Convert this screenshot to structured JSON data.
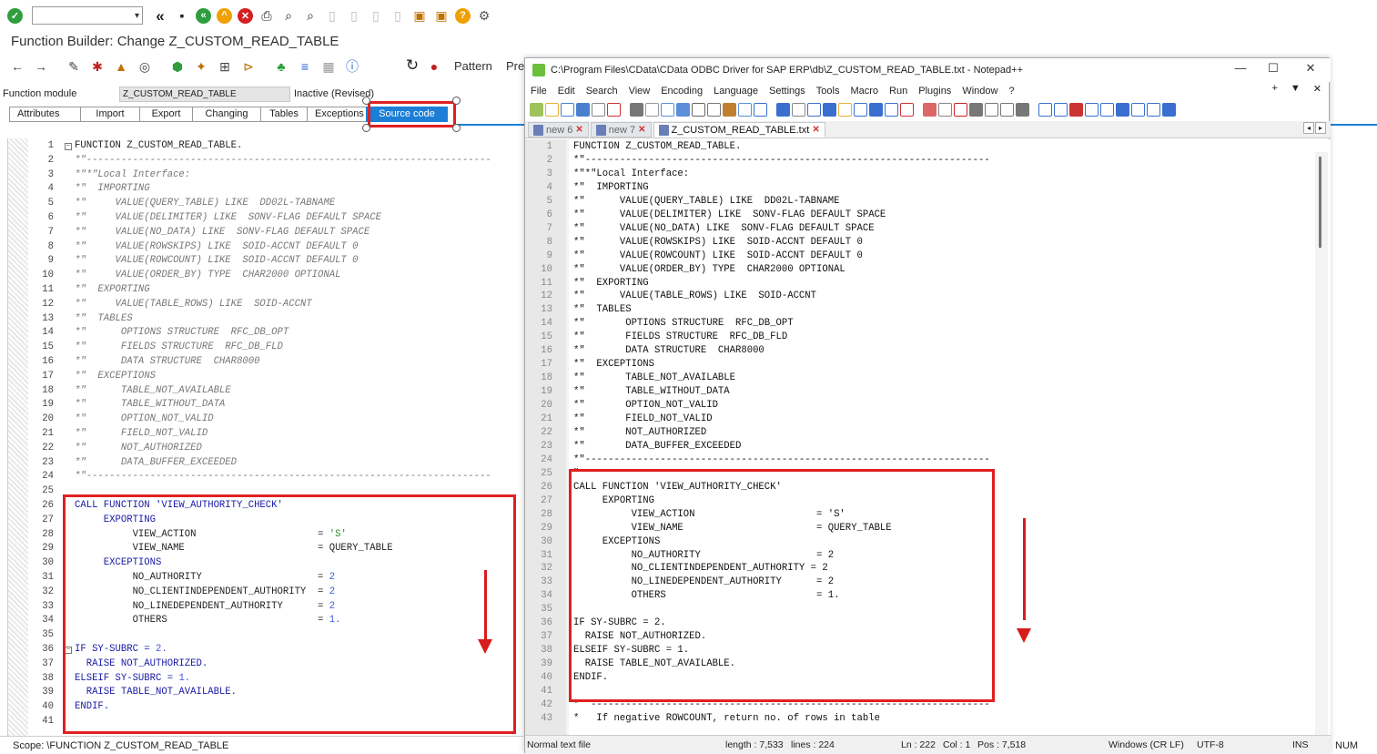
{
  "sap": {
    "title": "Function Builder: Change Z_CUSTOM_READ_TABLE",
    "function_module_label": "Function module",
    "function_module_value": "Z_CUSTOM_READ_TABLE",
    "status": "Inactive (Revised)",
    "pattern_label": "Pattern",
    "pretty_label": "Pre",
    "tabs": [
      "Attributes",
      "Import",
      "Export",
      "Changing",
      "Tables",
      "Exceptions",
      "Source code"
    ],
    "active_tab": "Source code",
    "scope": "Scope: \\FUNCTION Z_CUSTOM_READ_TABLE",
    "num_status": "NUM",
    "lines": [
      {
        "n": "1",
        "t": "FUNCTION Z_CUSTOM_READ_TABLE."
      },
      {
        "n": "2",
        "t": "*\"----------------------------------------------------------------------"
      },
      {
        "n": "3",
        "t": "*\"*\"Local Interface:"
      },
      {
        "n": "4",
        "t": "*\"  IMPORTING"
      },
      {
        "n": "5",
        "t": "*\"     VALUE(QUERY_TABLE) LIKE  DD02L-TABNAME"
      },
      {
        "n": "6",
        "t": "*\"     VALUE(DELIMITER) LIKE  SONV-FLAG DEFAULT SPACE"
      },
      {
        "n": "7",
        "t": "*\"     VALUE(NO_DATA) LIKE  SONV-FLAG DEFAULT SPACE"
      },
      {
        "n": "8",
        "t": "*\"     VALUE(ROWSKIPS) LIKE  SOID-ACCNT DEFAULT 0"
      },
      {
        "n": "9",
        "t": "*\"     VALUE(ROWCOUNT) LIKE  SOID-ACCNT DEFAULT 0"
      },
      {
        "n": "10",
        "t": "*\"     VALUE(ORDER_BY) TYPE  CHAR2000 OPTIONAL"
      },
      {
        "n": "11",
        "t": "*\"  EXPORTING"
      },
      {
        "n": "12",
        "t": "*\"     VALUE(TABLE_ROWS) LIKE  SOID-ACCNT"
      },
      {
        "n": "13",
        "t": "*\"  TABLES"
      },
      {
        "n": "14",
        "t": "*\"      OPTIONS STRUCTURE  RFC_DB_OPT"
      },
      {
        "n": "15",
        "t": "*\"      FIELDS STRUCTURE  RFC_DB_FLD"
      },
      {
        "n": "16",
        "t": "*\"      DATA STRUCTURE  CHAR8000"
      },
      {
        "n": "17",
        "t": "*\"  EXCEPTIONS"
      },
      {
        "n": "18",
        "t": "*\"      TABLE_NOT_AVAILABLE"
      },
      {
        "n": "19",
        "t": "*\"      TABLE_WITHOUT_DATA"
      },
      {
        "n": "20",
        "t": "*\"      OPTION_NOT_VALID"
      },
      {
        "n": "21",
        "t": "*\"      FIELD_NOT_VALID"
      },
      {
        "n": "22",
        "t": "*\"      NOT_AUTHORIZED"
      },
      {
        "n": "23",
        "t": "*\"      DATA_BUFFER_EXCEEDED"
      },
      {
        "n": "24",
        "t": "*\"----------------------------------------------------------------------"
      },
      {
        "n": "25",
        "t": ""
      },
      {
        "n": "26",
        "t": "CALL FUNCTION 'VIEW_AUTHORITY_CHECK'"
      },
      {
        "n": "27",
        "t": "     EXPORTING"
      },
      {
        "n": "28",
        "t": "          VIEW_ACTION                     = 'S'"
      },
      {
        "n": "29",
        "t": "          VIEW_NAME                       = QUERY_TABLE"
      },
      {
        "n": "30",
        "t": "     EXCEPTIONS"
      },
      {
        "n": "31",
        "t": "          NO_AUTHORITY                    = 2"
      },
      {
        "n": "32",
        "t": "          NO_CLIENTINDEPENDENT_AUTHORITY  = 2"
      },
      {
        "n": "33",
        "t": "          NO_LINEDEPENDENT_AUTHORITY      = 2"
      },
      {
        "n": "34",
        "t": "          OTHERS                          = 1."
      },
      {
        "n": "35",
        "t": ""
      },
      {
        "n": "36",
        "t": "IF SY-SUBRC = 2."
      },
      {
        "n": "37",
        "t": "  RAISE NOT_AUTHORIZED."
      },
      {
        "n": "38",
        "t": "ELSEIF SY-SUBRC = 1."
      },
      {
        "n": "39",
        "t": "  RAISE TABLE_NOT_AVAILABLE."
      },
      {
        "n": "40",
        "t": "ENDIF."
      },
      {
        "n": "41",
        "t": ""
      }
    ]
  },
  "npp": {
    "title": "C:\\Program Files\\CData\\CData ODBC Driver for SAP ERP\\db\\Z_CUSTOM_READ_TABLE.txt - Notepad++",
    "menu": [
      "File",
      "Edit",
      "Search",
      "View",
      "Encoding",
      "Language",
      "Settings",
      "Tools",
      "Macro",
      "Run",
      "Plugins",
      "Window",
      "?"
    ],
    "tabs": [
      "new 6",
      "new 7",
      "Z_CUSTOM_READ_TABLE.txt"
    ],
    "active_tab": "Z_CUSTOM_READ_TABLE.txt",
    "status": {
      "type": "Normal text file",
      "length": "length : 7,533",
      "lines": "lines : 224",
      "ln": "Ln : 222",
      "col": "Col : 1",
      "pos": "Pos : 7,518",
      "eol": "Windows (CR LF)",
      "enc": "UTF-8",
      "ins": "INS"
    },
    "lines": [
      {
        "n": "1",
        "t": "FUNCTION Z_CUSTOM_READ_TABLE."
      },
      {
        "n": "2",
        "t": "*\"----------------------------------------------------------------------"
      },
      {
        "n": "3",
        "t": "*\"*\"Local Interface:"
      },
      {
        "n": "4",
        "t": "*\"  IMPORTING"
      },
      {
        "n": "5",
        "t": "*\"      VALUE(QUERY_TABLE) LIKE  DD02L-TABNAME"
      },
      {
        "n": "6",
        "t": "*\"      VALUE(DELIMITER) LIKE  SONV-FLAG DEFAULT SPACE"
      },
      {
        "n": "7",
        "t": "*\"      VALUE(NO_DATA) LIKE  SONV-FLAG DEFAULT SPACE"
      },
      {
        "n": "8",
        "t": "*\"      VALUE(ROWSKIPS) LIKE  SOID-ACCNT DEFAULT 0"
      },
      {
        "n": "9",
        "t": "*\"      VALUE(ROWCOUNT) LIKE  SOID-ACCNT DEFAULT 0"
      },
      {
        "n": "10",
        "t": "*\"      VALUE(ORDER_BY) TYPE  CHAR2000 OPTIONAL"
      },
      {
        "n": "11",
        "t": "*\"  EXPORTING"
      },
      {
        "n": "12",
        "t": "*\"      VALUE(TABLE_ROWS) LIKE  SOID-ACCNT"
      },
      {
        "n": "13",
        "t": "*\"  TABLES"
      },
      {
        "n": "14",
        "t": "*\"       OPTIONS STRUCTURE  RFC_DB_OPT"
      },
      {
        "n": "15",
        "t": "*\"       FIELDS STRUCTURE  RFC_DB_FLD"
      },
      {
        "n": "16",
        "t": "*\"       DATA STRUCTURE  CHAR8000"
      },
      {
        "n": "17",
        "t": "*\"  EXCEPTIONS"
      },
      {
        "n": "18",
        "t": "*\"       TABLE_NOT_AVAILABLE"
      },
      {
        "n": "19",
        "t": "*\"       TABLE_WITHOUT_DATA"
      },
      {
        "n": "20",
        "t": "*\"       OPTION_NOT_VALID"
      },
      {
        "n": "21",
        "t": "*\"       FIELD_NOT_VALID"
      },
      {
        "n": "22",
        "t": "*\"       NOT_AUTHORIZED"
      },
      {
        "n": "23",
        "t": "*\"       DATA_BUFFER_EXCEEDED"
      },
      {
        "n": "24",
        "t": "*\"----------------------------------------------------------------------"
      },
      {
        "n": "25",
        "t": "\""
      },
      {
        "n": "26",
        "t": "CALL FUNCTION 'VIEW_AUTHORITY_CHECK'"
      },
      {
        "n": "27",
        "t": "     EXPORTING"
      },
      {
        "n": "28",
        "t": "          VIEW_ACTION                     = 'S'"
      },
      {
        "n": "29",
        "t": "          VIEW_NAME                       = QUERY_TABLE"
      },
      {
        "n": "30",
        "t": "     EXCEPTIONS"
      },
      {
        "n": "31",
        "t": "          NO_AUTHORITY                    = 2"
      },
      {
        "n": "32",
        "t": "          NO_CLIENTINDEPENDENT_AUTHORITY = 2"
      },
      {
        "n": "33",
        "t": "          NO_LINEDEPENDENT_AUTHORITY      = 2"
      },
      {
        "n": "34",
        "t": "          OTHERS                          = 1."
      },
      {
        "n": "35",
        "t": ""
      },
      {
        "n": "36",
        "t": "IF SY-SUBRC = 2."
      },
      {
        "n": "37",
        "t": "  RAISE NOT_AUTHORIZED."
      },
      {
        "n": "38",
        "t": "ELSEIF SY-SUBRC = 1."
      },
      {
        "n": "39",
        "t": "  RAISE TABLE_NOT_AVAILABLE."
      },
      {
        "n": "40",
        "t": "ENDIF."
      },
      {
        "n": "41",
        "t": ""
      },
      {
        "n": "42",
        "t": "*  ---------------------------------------------------------------------"
      },
      {
        "n": "43",
        "t": "*   If negative ROWCOUNT, return no. of rows in table"
      }
    ]
  },
  "colors": {
    "highlight_red": "#e02020",
    "sap_blue": "#1c7ed6"
  },
  "icons": [
    "check-icon",
    "back-icon",
    "save-icon",
    "exit-icon",
    "cancel-icon",
    "print-icon",
    "find-icon",
    "help-icon",
    "settings-icon"
  ]
}
